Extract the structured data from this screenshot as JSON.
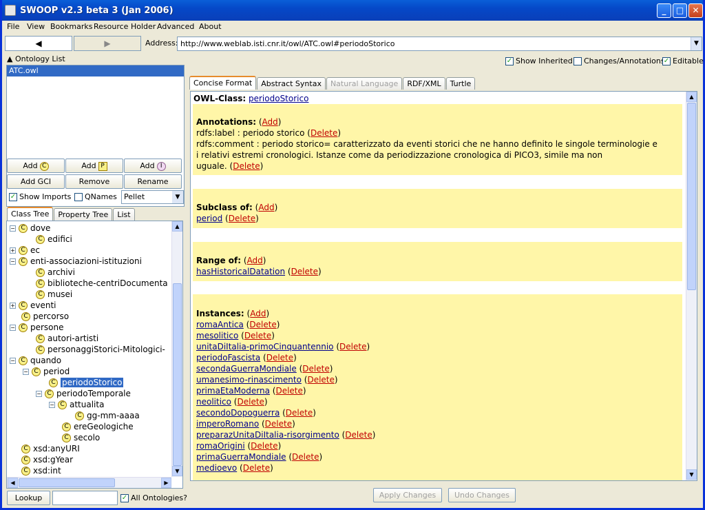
{
  "window": {
    "title": "SWOOP v2.3 beta 3 (Jan 2006)"
  },
  "menu": [
    "File",
    "View",
    "Bookmarks",
    "Resource Holder",
    "Advanced",
    "About"
  ],
  "nav": {
    "back": "◀",
    "forward": "▶",
    "address_label": "Address:",
    "address": "http://www.weblab.isti.cnr.it/owl/ATC.owl#periodoStorico"
  },
  "ontology_list": {
    "header": "Ontology List",
    "items": [
      "ATC.owl"
    ]
  },
  "buttons": {
    "add_c": "Add",
    "add_p": "Add",
    "add_i": "Add",
    "add_gci": "Add GCI",
    "remove": "Remove",
    "rename": "Rename",
    "lookup": "Lookup",
    "apply": "Apply Changes",
    "undo": "Undo Changes"
  },
  "icons": {
    "c": "C",
    "p": "P",
    "i": "I"
  },
  "options": {
    "show_imports": "Show Imports",
    "qnames": "QNames",
    "reasoner": "Pellet",
    "all_ontologies": "All Ontologies?",
    "show_inherited": "Show Inherited",
    "changes": "Changes/Annotations",
    "editable": "Editable"
  },
  "left_tabs": [
    "Class Tree",
    "Property Tree",
    "List"
  ],
  "tree": [
    "dove",
    "edifici",
    "ec",
    "enti-associazioni-istituzioni",
    "archivi",
    "biblioteche-centriDocumenta",
    "musei",
    "eventi",
    "percorso",
    "persone",
    "autori-artisti",
    "personaggiStorici-Mitologici-",
    "quando",
    "period",
    "periodoStorico",
    "periodoTemporale",
    "attualita",
    "gg-mm-aaaa",
    "ereGeologiche",
    "secolo",
    "xsd:anyURI",
    "xsd:gYear",
    "xsd:int"
  ],
  "right_tabs": [
    "Concise Format",
    "Abstract Syntax",
    "Natural Language",
    "RDF/XML",
    "Turtle"
  ],
  "content": {
    "owl_class_label": "OWL-Class:",
    "owl_class": "periodoStorico",
    "annotations_label": "Annotations:",
    "add": "Add",
    "delete": "Delete",
    "label_line": "rdfs:label : periodo storico",
    "comment_1": "rdfs:comment : periodo storico= caratterizzato da eventi storici che ne hanno definito le singole terminologie e",
    "comment_2": "i relativi estremi cronologici. Istanze come da periodizzazione cronologica di PICO3, simile ma non",
    "comment_3": "uguale.",
    "subclass_label": "Subclass of:",
    "subclass": "period",
    "range_label": "Range of:",
    "range": "hasHistoricalDatation",
    "instances_label": "Instances:",
    "instances": [
      "romaAntica",
      "mesolitico",
      "unitaDiItalia-primoCinquantennio",
      "periodoFascista",
      "secondaGuerraMondiale",
      "umanesimo-rinascimento",
      "primaEtaModerna",
      "neolitico",
      "secondoDopoguerra",
      "imperoRomano",
      "preparazUnitaDiItalia-risorgimento",
      "romaOrigini",
      "primaGuerraMondiale",
      "medioevo"
    ]
  },
  "colors": {
    "title_bar": "#0548c8",
    "section_bg": "#fff6a8",
    "selection": "#316ac5",
    "link": "#00008b",
    "delete": "#c00000"
  }
}
